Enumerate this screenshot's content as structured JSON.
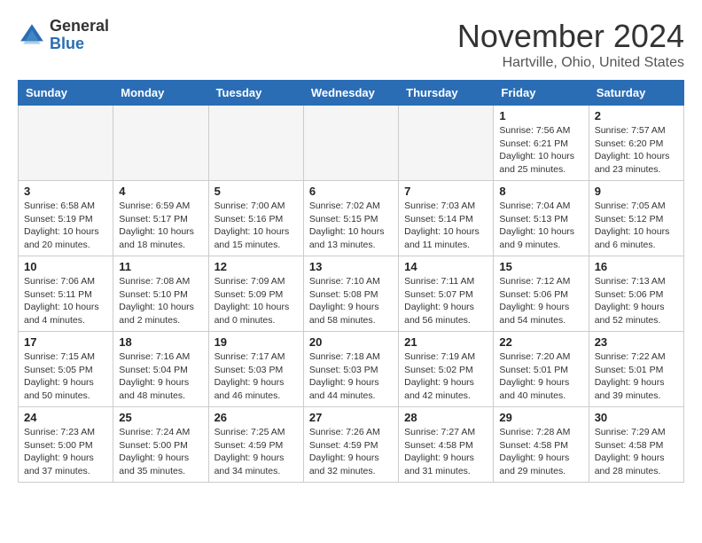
{
  "header": {
    "logo_line1": "General",
    "logo_line2": "Blue",
    "month_title": "November 2024",
    "location": "Hartville, Ohio, United States"
  },
  "days_of_week": [
    "Sunday",
    "Monday",
    "Tuesday",
    "Wednesday",
    "Thursday",
    "Friday",
    "Saturday"
  ],
  "weeks": [
    [
      {
        "day": "",
        "info": ""
      },
      {
        "day": "",
        "info": ""
      },
      {
        "day": "",
        "info": ""
      },
      {
        "day": "",
        "info": ""
      },
      {
        "day": "",
        "info": ""
      },
      {
        "day": "1",
        "info": "Sunrise: 7:56 AM\nSunset: 6:21 PM\nDaylight: 10 hours\nand 25 minutes."
      },
      {
        "day": "2",
        "info": "Sunrise: 7:57 AM\nSunset: 6:20 PM\nDaylight: 10 hours\nand 23 minutes."
      }
    ],
    [
      {
        "day": "3",
        "info": "Sunrise: 6:58 AM\nSunset: 5:19 PM\nDaylight: 10 hours\nand 20 minutes."
      },
      {
        "day": "4",
        "info": "Sunrise: 6:59 AM\nSunset: 5:17 PM\nDaylight: 10 hours\nand 18 minutes."
      },
      {
        "day": "5",
        "info": "Sunrise: 7:00 AM\nSunset: 5:16 PM\nDaylight: 10 hours\nand 15 minutes."
      },
      {
        "day": "6",
        "info": "Sunrise: 7:02 AM\nSunset: 5:15 PM\nDaylight: 10 hours\nand 13 minutes."
      },
      {
        "day": "7",
        "info": "Sunrise: 7:03 AM\nSunset: 5:14 PM\nDaylight: 10 hours\nand 11 minutes."
      },
      {
        "day": "8",
        "info": "Sunrise: 7:04 AM\nSunset: 5:13 PM\nDaylight: 10 hours\nand 9 minutes."
      },
      {
        "day": "9",
        "info": "Sunrise: 7:05 AM\nSunset: 5:12 PM\nDaylight: 10 hours\nand 6 minutes."
      }
    ],
    [
      {
        "day": "10",
        "info": "Sunrise: 7:06 AM\nSunset: 5:11 PM\nDaylight: 10 hours\nand 4 minutes."
      },
      {
        "day": "11",
        "info": "Sunrise: 7:08 AM\nSunset: 5:10 PM\nDaylight: 10 hours\nand 2 minutes."
      },
      {
        "day": "12",
        "info": "Sunrise: 7:09 AM\nSunset: 5:09 PM\nDaylight: 10 hours\nand 0 minutes."
      },
      {
        "day": "13",
        "info": "Sunrise: 7:10 AM\nSunset: 5:08 PM\nDaylight: 9 hours\nand 58 minutes."
      },
      {
        "day": "14",
        "info": "Sunrise: 7:11 AM\nSunset: 5:07 PM\nDaylight: 9 hours\nand 56 minutes."
      },
      {
        "day": "15",
        "info": "Sunrise: 7:12 AM\nSunset: 5:06 PM\nDaylight: 9 hours\nand 54 minutes."
      },
      {
        "day": "16",
        "info": "Sunrise: 7:13 AM\nSunset: 5:06 PM\nDaylight: 9 hours\nand 52 minutes."
      }
    ],
    [
      {
        "day": "17",
        "info": "Sunrise: 7:15 AM\nSunset: 5:05 PM\nDaylight: 9 hours\nand 50 minutes."
      },
      {
        "day": "18",
        "info": "Sunrise: 7:16 AM\nSunset: 5:04 PM\nDaylight: 9 hours\nand 48 minutes."
      },
      {
        "day": "19",
        "info": "Sunrise: 7:17 AM\nSunset: 5:03 PM\nDaylight: 9 hours\nand 46 minutes."
      },
      {
        "day": "20",
        "info": "Sunrise: 7:18 AM\nSunset: 5:03 PM\nDaylight: 9 hours\nand 44 minutes."
      },
      {
        "day": "21",
        "info": "Sunrise: 7:19 AM\nSunset: 5:02 PM\nDaylight: 9 hours\nand 42 minutes."
      },
      {
        "day": "22",
        "info": "Sunrise: 7:20 AM\nSunset: 5:01 PM\nDaylight: 9 hours\nand 40 minutes."
      },
      {
        "day": "23",
        "info": "Sunrise: 7:22 AM\nSunset: 5:01 PM\nDaylight: 9 hours\nand 39 minutes."
      }
    ],
    [
      {
        "day": "24",
        "info": "Sunrise: 7:23 AM\nSunset: 5:00 PM\nDaylight: 9 hours\nand 37 minutes."
      },
      {
        "day": "25",
        "info": "Sunrise: 7:24 AM\nSunset: 5:00 PM\nDaylight: 9 hours\nand 35 minutes."
      },
      {
        "day": "26",
        "info": "Sunrise: 7:25 AM\nSunset: 4:59 PM\nDaylight: 9 hours\nand 34 minutes."
      },
      {
        "day": "27",
        "info": "Sunrise: 7:26 AM\nSunset: 4:59 PM\nDaylight: 9 hours\nand 32 minutes."
      },
      {
        "day": "28",
        "info": "Sunrise: 7:27 AM\nSunset: 4:58 PM\nDaylight: 9 hours\nand 31 minutes."
      },
      {
        "day": "29",
        "info": "Sunrise: 7:28 AM\nSunset: 4:58 PM\nDaylight: 9 hours\nand 29 minutes."
      },
      {
        "day": "30",
        "info": "Sunrise: 7:29 AM\nSunset: 4:58 PM\nDaylight: 9 hours\nand 28 minutes."
      }
    ]
  ]
}
